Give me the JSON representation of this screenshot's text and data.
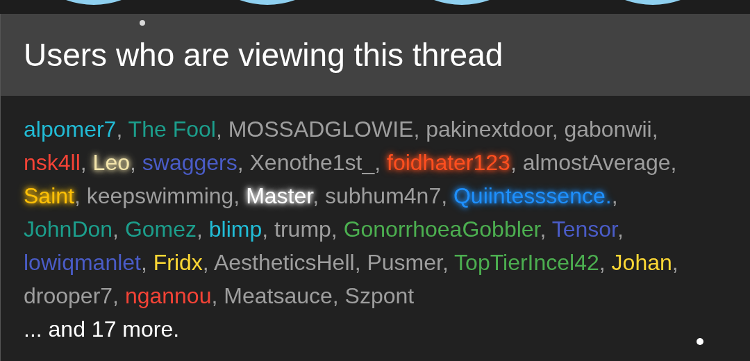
{
  "title": "Users who are viewing this thread",
  "lines": [
    [
      {
        "name": "alpomer7",
        "color": "#22bcd6",
        "glow": false
      },
      {
        "name": "The Fool",
        "color": "#1c9e8c",
        "glow": false
      },
      {
        "name": "MOSSADGLOWIE",
        "color": "#9e9e9e",
        "glow": false
      },
      {
        "name": "pakinextdoor",
        "color": "#9e9e9e",
        "glow": false
      },
      {
        "name": "gabonwii",
        "color": "#9e9e9e",
        "glow": false
      }
    ],
    [
      {
        "name": "nsk4ll",
        "color": "#f44336",
        "glow": false
      },
      {
        "name": "Leo",
        "color": "#f3e5ab",
        "glow": true
      },
      {
        "name": "swaggers",
        "color": "#4a5cc7",
        "glow": false
      },
      {
        "name": "Xenothe1st_",
        "color": "#9e9e9e",
        "glow": false
      },
      {
        "name": "foidhater123",
        "color": "#ff4f1f",
        "glow": true
      },
      {
        "name": "almostAverage",
        "color": "#9e9e9e",
        "glow": false
      }
    ],
    [
      {
        "name": "Saint",
        "color": "#ffc107",
        "glow": true
      },
      {
        "name": "keepswimming",
        "color": "#9e9e9e",
        "glow": false
      },
      {
        "name": "Master",
        "color": "#ffffff",
        "glow": true
      },
      {
        "name": "subhum4n7",
        "color": "#9e9e9e",
        "glow": false
      },
      {
        "name": "Quiintesssence.",
        "color": "#1e90ff",
        "glow": true
      }
    ],
    [
      {
        "name": "JohnDon",
        "color": "#1c9e8c",
        "glow": false
      },
      {
        "name": "Gomez",
        "color": "#1c9e8c",
        "glow": false
      },
      {
        "name": "blimp",
        "color": "#22bcd6",
        "glow": false
      },
      {
        "name": "trump",
        "color": "#9e9e9e",
        "glow": false
      },
      {
        "name": "GonorrhoeaGobbler",
        "color": "#4caf50",
        "glow": false
      },
      {
        "name": "Tensor",
        "color": "#4a5cc7",
        "glow": false
      }
    ],
    [
      {
        "name": "lowiqmanlet",
        "color": "#4a5cc7",
        "glow": false
      },
      {
        "name": "Fridx",
        "color": "#fdd835",
        "glow": false
      },
      {
        "name": "AestheticsHell",
        "color": "#9e9e9e",
        "glow": false
      },
      {
        "name": "Pusmer",
        "color": "#9e9e9e",
        "glow": false
      },
      {
        "name": "TopTierIncel42",
        "color": "#4caf50",
        "glow": false
      },
      {
        "name": "Johan",
        "color": "#fdd835",
        "glow": false
      }
    ],
    [
      {
        "name": "drooper7",
        "color": "#9e9e9e",
        "glow": false
      },
      {
        "name": "ngannou",
        "color": "#f44336",
        "glow": false
      },
      {
        "name": "Meatsauce",
        "color": "#9e9e9e",
        "glow": false
      },
      {
        "name": "Szpont",
        "color": "#9e9e9e",
        "glow": false
      }
    ]
  ],
  "separator": ",",
  "more": "... and 17 more."
}
